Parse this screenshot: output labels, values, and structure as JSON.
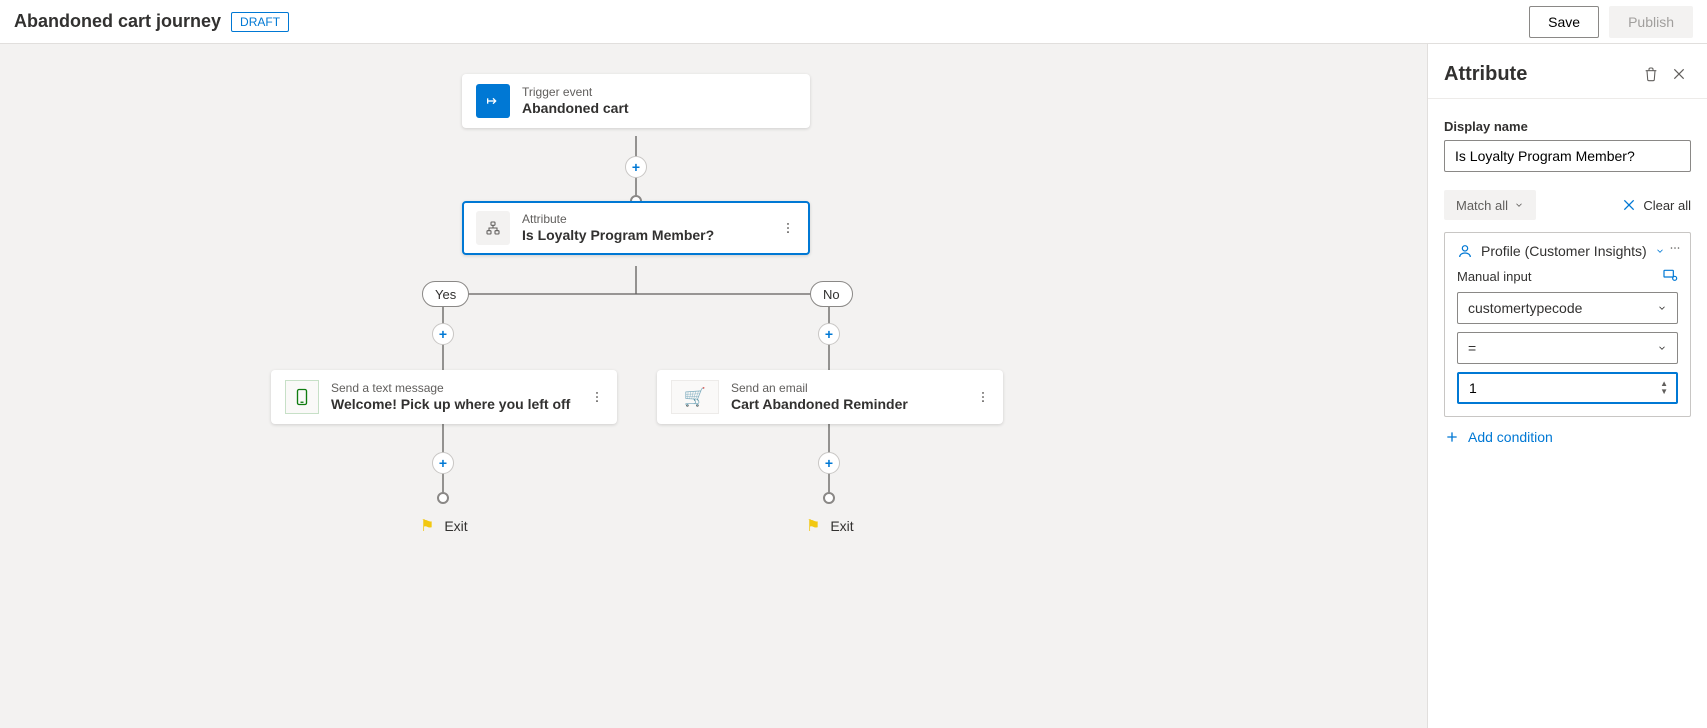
{
  "header": {
    "title": "Abandoned cart journey",
    "status": "DRAFT",
    "save_label": "Save",
    "publish_label": "Publish"
  },
  "canvas": {
    "trigger": {
      "kicker": "Trigger event",
      "label": "Abandoned cart"
    },
    "attribute": {
      "kicker": "Attribute",
      "label": "Is Loyalty Program Member?"
    },
    "yes_label": "Yes",
    "no_label": "No",
    "sms": {
      "kicker": "Send a text message",
      "label": "Welcome! Pick up where you left off"
    },
    "email": {
      "kicker": "Send an email",
      "label": "Cart Abandoned Reminder"
    },
    "exit_label": "Exit"
  },
  "panel": {
    "title": "Attribute",
    "display_name_label": "Display name",
    "display_name_value": "Is Loyalty Program Member?",
    "match_label": "Match all",
    "clear_label": "Clear all",
    "source_label": "Profile (Customer Insights)",
    "manual_label": "Manual input",
    "field_value": "customertypecode",
    "operator_value": "=",
    "value_input": "1",
    "add_condition_label": "Add condition"
  }
}
